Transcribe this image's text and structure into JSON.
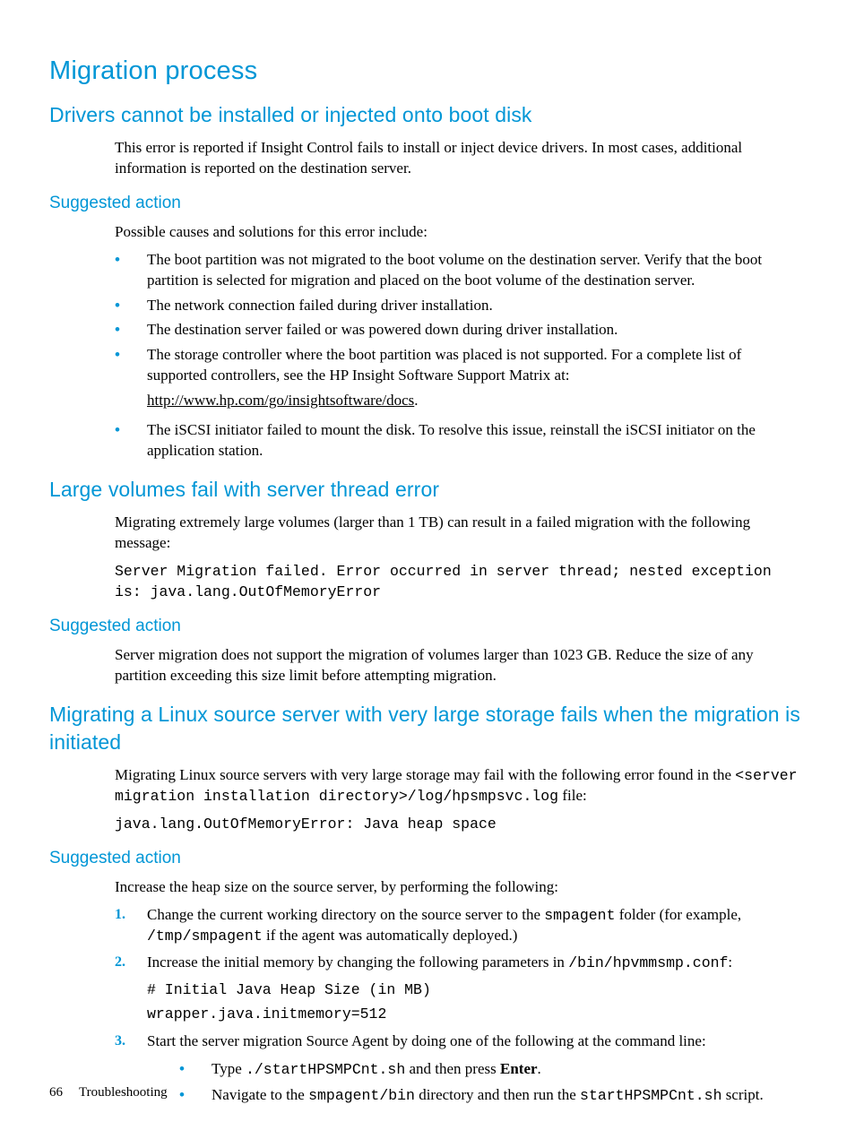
{
  "h1": "Migration process",
  "s1": {
    "h2": "Drivers cannot be installed or injected onto boot disk",
    "p1": "This error is reported if Insight Control fails to install or inject device drivers. In most cases, additional information is reported on the destination server.",
    "h3": "Suggested action",
    "p2": "Possible causes and solutions for this error include:",
    "b1": "The boot partition was not migrated to the boot volume on the destination server. Verify that the boot partition is selected for migration and placed on the boot volume of the destination server.",
    "b2": "The network connection failed during driver installation.",
    "b3": "The destination server failed or was powered down during driver installation.",
    "b4": "The storage controller where the boot partition was placed is not supported. For a complete list of supported controllers, see the HP Insight Software Support Matrix at:",
    "b4link": "http://www.hp.com/go/insightsoftware/docs",
    "b4after": ".",
    "b5": "The iSCSI initiator failed to mount the disk. To resolve this issue, reinstall the iSCSI initiator on the application station."
  },
  "s2": {
    "h2": "Large volumes fail with server thread error",
    "p1": "Migrating extremely large volumes (larger than 1 TB) can result in a failed migration with the following message:",
    "code": "Server Migration failed. Error occurred in server thread; nested exception is: java.lang.OutOfMemoryError",
    "h3": "Suggested action",
    "p2": "Server migration does not support the migration of volumes larger than 1023 GB. Reduce the size of any partition exceeding this size limit before attempting migration."
  },
  "s3": {
    "h2": "Migrating a Linux source server with very large storage fails when the migration is initiated",
    "p1a": "Migrating Linux source servers with very large storage may fail with the following error found in the ",
    "p1code": "<server migration installation directory>/log/hpsmpsvc.log",
    "p1b": " file:",
    "code": "java.lang.OutOfMemoryError: Java heap space",
    "h3": "Suggested action",
    "p2": "Increase the heap size on the source server, by performing the following:",
    "n1a": "Change the current working directory on the source server to the ",
    "n1code": "smpagent",
    "n1b": " folder (for example, ",
    "n1code2": "/tmp/smpagent",
    "n1c": " if the agent was automatically deployed.)",
    "n2a": "Increase the initial memory by changing the following parameters in ",
    "n2code": "/bin/hpvmmsmp.conf",
    "n2b": ":",
    "n2block1": "# Initial Java Heap Size (in MB)",
    "n2block2": "wrapper.java.initmemory=512",
    "n3": "Start the server migration Source Agent by doing one of the following at the command line:",
    "n3s1a": "Type ",
    "n3s1code": "./startHPSMPCnt.sh",
    "n3s1b": " and then press ",
    "n3s1bold": "Enter",
    "n3s1c": ".",
    "n3s2a": "Navigate to the ",
    "n3s2code1": "smpagent/bin",
    "n3s2b": " directory and then run the ",
    "n3s2code2": "startHPSMPCnt.sh",
    "n3s2c": " script."
  },
  "footer": {
    "page": "66",
    "section": "Troubleshooting"
  }
}
